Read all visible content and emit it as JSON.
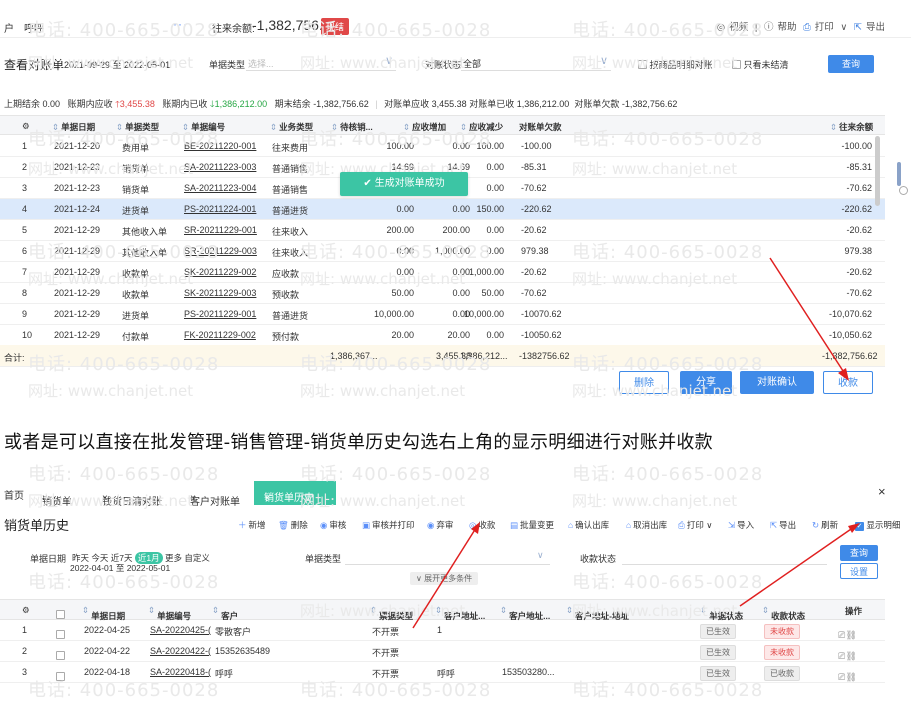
{
  "top": {
    "left_labels": [
      "户",
      "呼呼"
    ],
    "dots": "···",
    "balance_label": "往来余额:",
    "balance_value": "-1,382,756.62",
    "cash_badge": "现结",
    "right_items": [
      "视频",
      "|",
      "帮助",
      "打印",
      "导出"
    ]
  },
  "filter": {
    "title": "查看对账单",
    "date_range": "2021-09-29 至 2022-05-01",
    "doc_type_label": "单据类型",
    "doc_type_placeholder": "选择...",
    "status_label": "对账状态",
    "status_value": "全部",
    "check1_label": "按商品明细对账",
    "check2_label": "只看未结清",
    "query_button": "查询"
  },
  "summary": {
    "opening_label": "上期结余",
    "opening_value": "0.00",
    "receivable_label": "账期内应收",
    "receivable_value": "3,455.38",
    "received_label": "账期内已收",
    "received_value": "1,386,212.00",
    "closing_label": "期末结余",
    "closing_value": "-1,382,756.62",
    "stmt_recv_label": "对账单应收",
    "stmt_recv_value": "3,455.38",
    "stmt_got_label": "对账单已收",
    "stmt_got_value": "1,386,212.00",
    "stmt_owed_label": "对账单欠款",
    "stmt_owed_value": "-1,382,756.62"
  },
  "table1": {
    "headers": [
      "单据日期",
      "单据类型",
      "单据编号",
      "业务类型",
      "待核销...",
      "应收增加",
      "应收减少",
      "对账单欠款",
      "往来余额"
    ],
    "rows": [
      [
        "1",
        "2021-12-20",
        "费用单",
        "BE-20211220-001",
        "往来费用",
        "100.00",
        "0.00",
        "100.00",
        "-100.00",
        "-100.00"
      ],
      [
        "2",
        "2021-12-23",
        "销货单",
        "SA-20211223-003",
        "普通销售",
        "14.69",
        "14.69",
        "0.00",
        "-85.31",
        "-85.31"
      ],
      [
        "3",
        "2021-12-23",
        "销货单",
        "SA-20211223-004",
        "普通销售",
        "",
        "",
        "0.00",
        "-70.62",
        "-70.62"
      ],
      [
        "4",
        "2021-12-24",
        "进货单",
        "PS-20211224-001",
        "普通进货",
        "0.00",
        "0.00",
        "150.00",
        "-220.62",
        "-220.62"
      ],
      [
        "5",
        "2021-12-29",
        "其他收入单",
        "SR-20211229-001",
        "往来收入",
        "200.00",
        "200.00",
        "0.00",
        "-20.62",
        "-20.62"
      ],
      [
        "6",
        "2021-12-29",
        "其他收入单",
        "SR-20211229-003",
        "往来收入",
        "0.00",
        "1,000.00",
        "0.00",
        "979.38",
        "979.38"
      ],
      [
        "7",
        "2021-12-29",
        "收款单",
        "SK-20211229-002",
        "应收款",
        "0.00",
        "0.00",
        "1,000.00",
        "-20.62",
        "-20.62"
      ],
      [
        "8",
        "2021-12-29",
        "收款单",
        "SK-20211229-003",
        "预收款",
        "50.00",
        "0.00",
        "50.00",
        "-70.62",
        "-70.62"
      ],
      [
        "9",
        "2021-12-29",
        "进货单",
        "PS-20211229-001",
        "普通进货",
        "10,000.00",
        "0.00",
        "10,000.00",
        "-10070.62",
        "-10,070.62"
      ],
      [
        "10",
        "2021-12-29",
        "付款单",
        "FK-20211229-002",
        "预付款",
        "20.00",
        "20.00",
        "0.00",
        "-10050.62",
        "-10,050.62"
      ]
    ],
    "total_label": "合计:",
    "total_values": [
      "1,386,367...",
      "3,455.38",
      "1,386,212...",
      "-1382756.62",
      "-1,382,756.62"
    ]
  },
  "toast": "生成对账单成功",
  "actions": {
    "delete": "删除",
    "share": "分享",
    "confirm": "对账确认",
    "collect": "收款"
  },
  "caption": "或者是可以直接在批发管理-销售管理-销货单历史勾选右上角的显示明细进行对账并收款",
  "tabs2": [
    "首页",
    "销货单",
    "钱货日清对账",
    "客户对账单",
    "销货单历史"
  ],
  "sales_history": {
    "title": "销货单历史",
    "toolbar": [
      "新增",
      "删除",
      "审核",
      "审核并打印",
      "弃审",
      "收款",
      "批量变更",
      "确认出库",
      "取消出库",
      "打印",
      "导入",
      "导出",
      "刷新",
      "显示明细"
    ],
    "date_label": "单据日期",
    "date_options": [
      "昨天",
      "今天",
      "近7天",
      "近1月",
      "更多",
      "自定义"
    ],
    "date_range": "2022-04-01 至 2022-05-01",
    "doc_type_label": "单据类型",
    "status_label": "收款状态",
    "query": "查询",
    "reset": "设置",
    "more": "展开更多条件",
    "headers": [
      "单据日期",
      "单据编号",
      "客户",
      "票据类型",
      "客户地址...",
      "客户地址...",
      "客户地址-地址",
      "单据状态",
      "收款状态",
      "操作"
    ],
    "rows": [
      [
        "1",
        "2022-04-25",
        "SA-20220425-(",
        "零散客户",
        "不开票",
        "1",
        "",
        "已生效",
        "未收款"
      ],
      [
        "2",
        "2022-04-22",
        "SA-20220422-(",
        "15352635489",
        "不开票",
        "",
        "",
        "已生效",
        "未收款"
      ],
      [
        "3",
        "2022-04-18",
        "SA-20220418-(",
        "呼呼",
        "不开票",
        "呼呼",
        "153503280...",
        "已生效",
        "已收款"
      ]
    ]
  },
  "watermark": {
    "tel": "电话: 400-665-0028",
    "url": "网址: www.chanjet.net"
  }
}
